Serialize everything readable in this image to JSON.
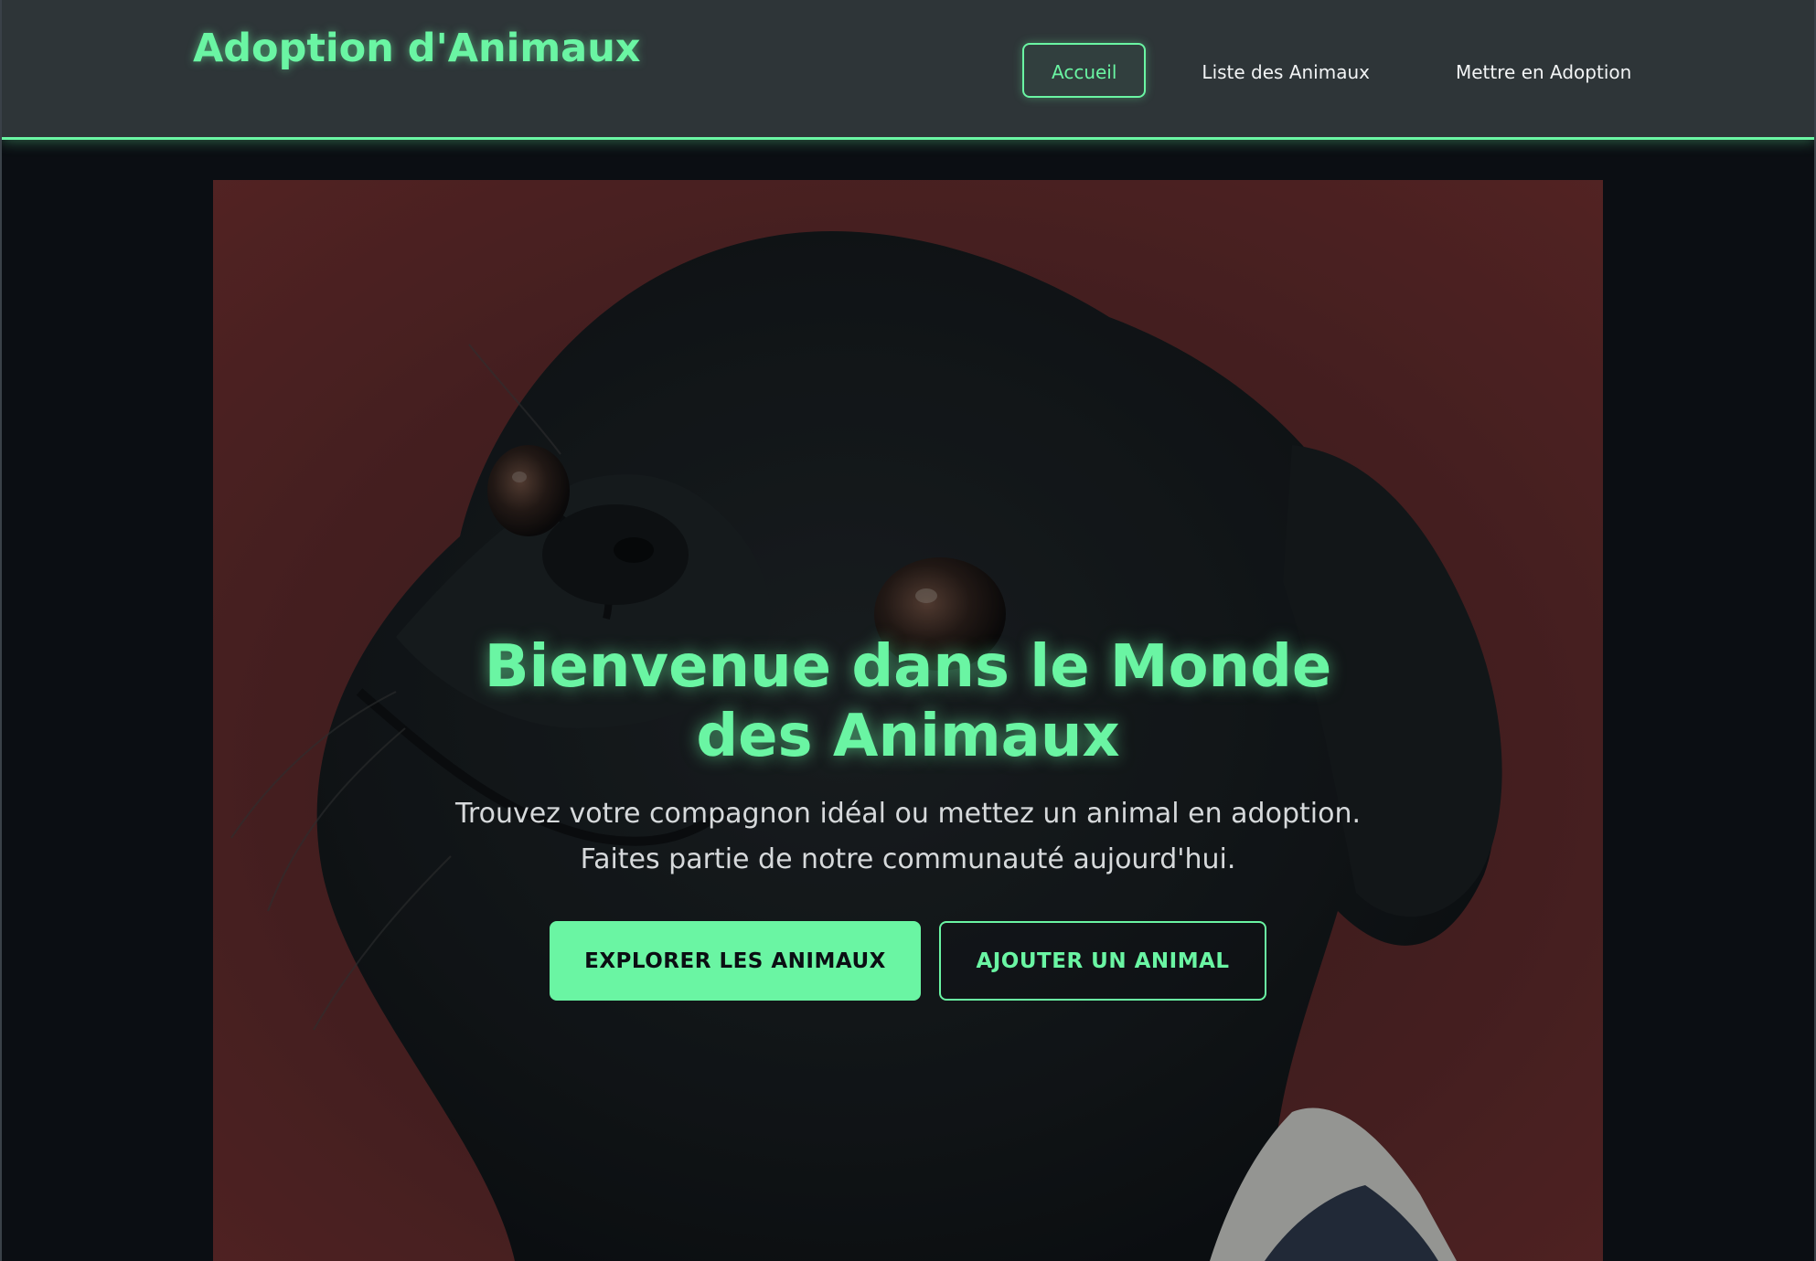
{
  "navbar": {
    "brand": "Adoption d'Animaux",
    "links": [
      {
        "label": "Accueil",
        "active": true
      },
      {
        "label": "Liste des Animaux",
        "active": false
      },
      {
        "label": "Mettre en Adoption",
        "active": false
      }
    ]
  },
  "hero": {
    "image": "pug-dog-photo",
    "title": "Bienvenue dans le Monde des Animaux",
    "subtitle": "Trouvez votre compagnon idéal ou mettez un animal en adoption. Faites partie de notre communauté aujourd'hui.",
    "primary_button": "EXPLORER LES ANIMAUX",
    "secondary_button": "AJOUTER UN ANIMAL"
  },
  "colors": {
    "accent": "#6af5a3",
    "navbar_bg": "#2e3538",
    "page_bg": "#0b0e13",
    "hero_bg": "#5a2424"
  }
}
